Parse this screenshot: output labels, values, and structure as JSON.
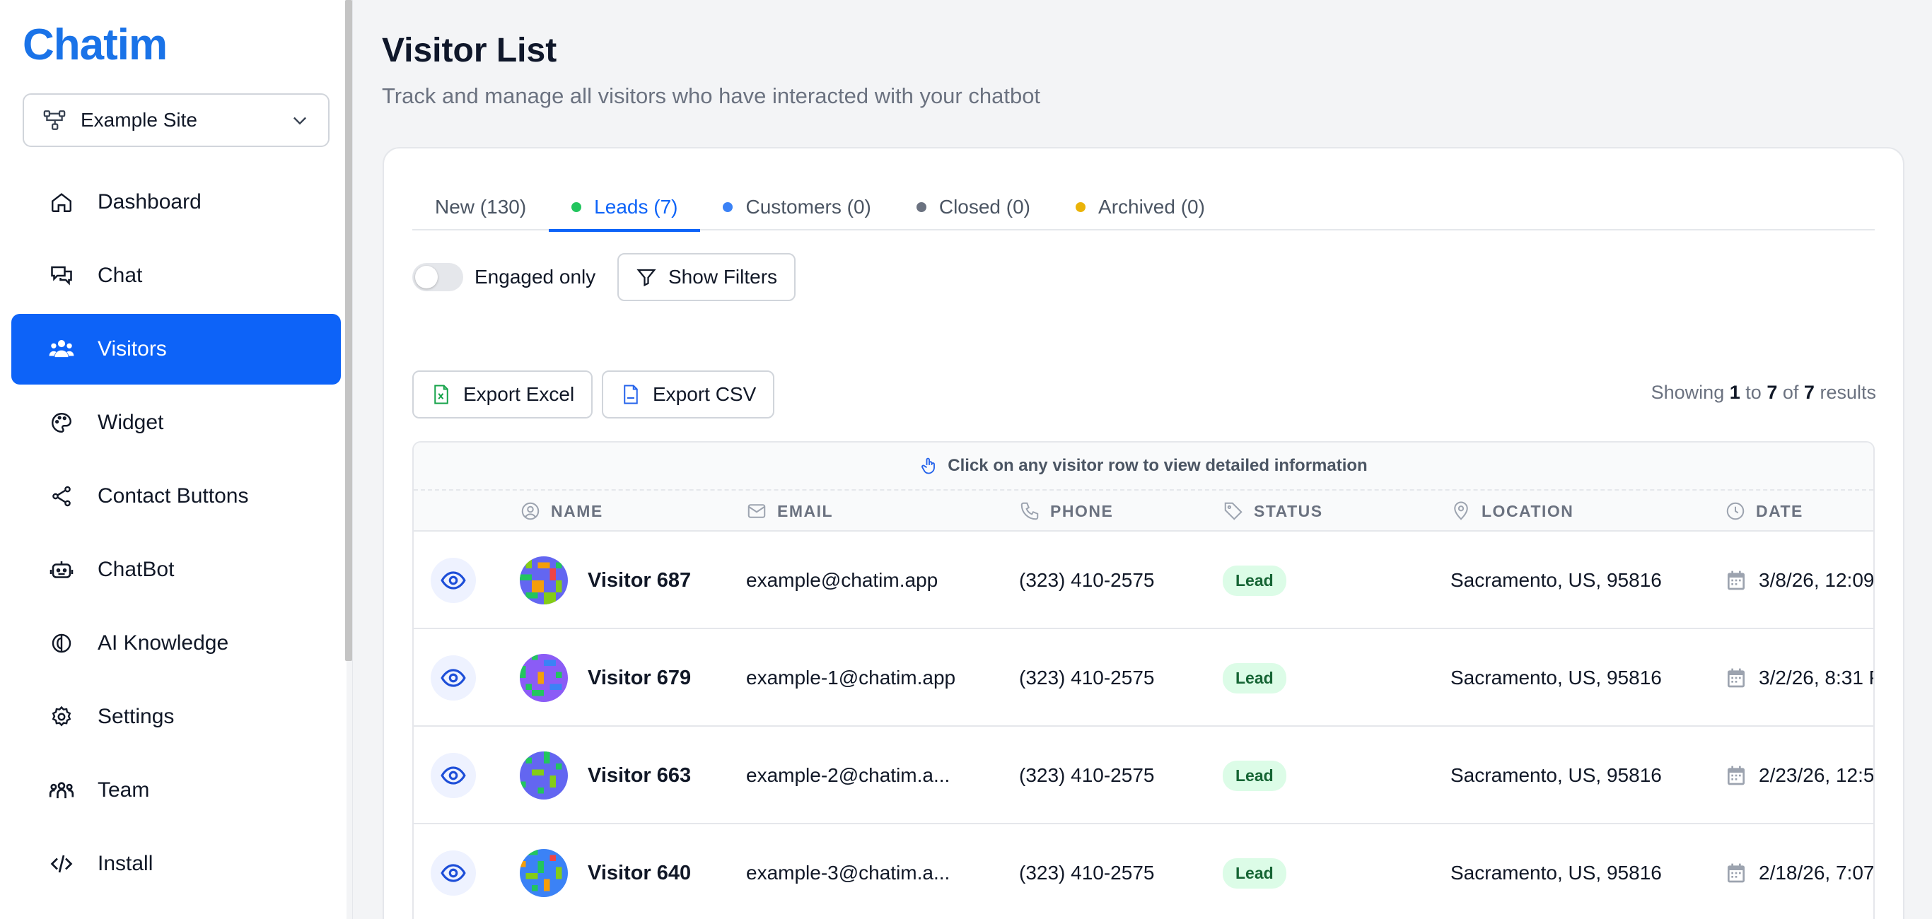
{
  "sidebar": {
    "logo": "Chatim",
    "site_selector": {
      "value": "Example Site",
      "icon": "sitemap-icon"
    },
    "items": [
      {
        "label": "Dashboard",
        "icon": "home-icon"
      },
      {
        "label": "Chat",
        "icon": "chat-icon"
      },
      {
        "label": "Visitors",
        "icon": "users-icon",
        "active": true
      },
      {
        "label": "Widget",
        "icon": "palette-icon"
      },
      {
        "label": "Contact Buttons",
        "icon": "share-icon"
      },
      {
        "label": "ChatBot",
        "icon": "bot-icon"
      },
      {
        "label": "AI Knowledge",
        "icon": "brain-icon"
      },
      {
        "label": "Settings",
        "icon": "gear-icon"
      },
      {
        "label": "Team",
        "icon": "team-icon"
      },
      {
        "label": "Install",
        "icon": "code-icon"
      }
    ]
  },
  "header": {
    "title": "Visitor List",
    "subtitle": "Track and manage all visitors who have interacted with your chatbot"
  },
  "tabs": [
    {
      "label": "New (130)",
      "dot": null
    },
    {
      "label": "Leads (7)",
      "dot": "#22c55e",
      "active": true
    },
    {
      "label": "Customers (0)",
      "dot": "#3b82f6"
    },
    {
      "label": "Closed (0)",
      "dot": "#6b7280"
    },
    {
      "label": "Archived (0)",
      "dot": "#eab308"
    }
  ],
  "filters": {
    "engaged_label": "Engaged only",
    "engaged_on": false,
    "show_filters_label": "Show Filters"
  },
  "export": {
    "excel_label": "Export Excel",
    "csv_label": "Export CSV"
  },
  "results": {
    "prefix": "Showing",
    "from": "1",
    "to_word": "to",
    "to": "7",
    "of_word": "of",
    "total": "7",
    "suffix": "results"
  },
  "table": {
    "hint": "Click on any visitor row to view detailed information",
    "columns": {
      "name": "NAME",
      "email": "EMAIL",
      "phone": "PHONE",
      "status": "STATUS",
      "location": "LOCATION",
      "date": "DATE"
    },
    "rows": [
      {
        "name": "Visitor 687",
        "email": "example@chatim.app",
        "phone": "(323) 410-2575",
        "status": "Lead",
        "location": "Sacramento, US, 95816",
        "date": "3/8/26, 12:09"
      },
      {
        "name": "Visitor 679",
        "email": "example-1@chatim.app",
        "phone": "(323) 410-2575",
        "status": "Lead",
        "location": "Sacramento, US, 95816",
        "date": "3/2/26, 8:31 P"
      },
      {
        "name": "Visitor 663",
        "email": "example-2@chatim.a...",
        "phone": "(323) 410-2575",
        "status": "Lead",
        "location": "Sacramento, US, 95816",
        "date": "2/23/26, 12:5"
      },
      {
        "name": "Visitor 640",
        "email": "example-3@chatim.a...",
        "phone": "(323) 410-2575",
        "status": "Lead",
        "location": "Sacramento, US, 95816",
        "date": "2/18/26, 7:07"
      }
    ]
  },
  "colors": {
    "accent": "#0d63f8",
    "lead_badge_bg": "#dcfce7",
    "lead_badge_text": "#166534"
  }
}
